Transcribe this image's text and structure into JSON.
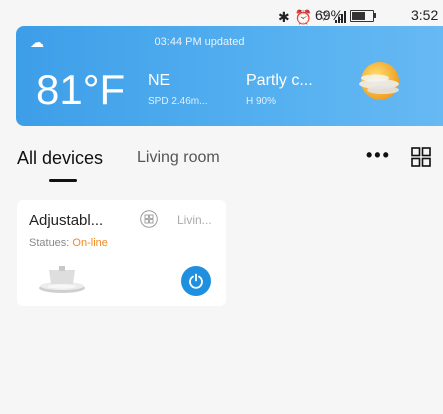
{
  "status_bar": {
    "battery": "69%",
    "time": "3:52",
    "network": "4G"
  },
  "weather": {
    "updated": "03:44 PM updated",
    "temperature": "81°F",
    "wind_direction": "NE",
    "wind_speed": "SPD 2.46m...",
    "condition": "Partly c...",
    "humidity": "H 90%",
    "icon": "partly-cloudy-icon"
  },
  "tabs": {
    "active": "All devices",
    "inactive": "Living room"
  },
  "device": {
    "name": "Adjustabl...",
    "room": "Livin...",
    "status_label": "Statues:",
    "status_value": "On-line"
  },
  "colors": {
    "accent": "#1f8fe0",
    "weather_bg": "#4aa8ee",
    "online": "#f08a24"
  }
}
